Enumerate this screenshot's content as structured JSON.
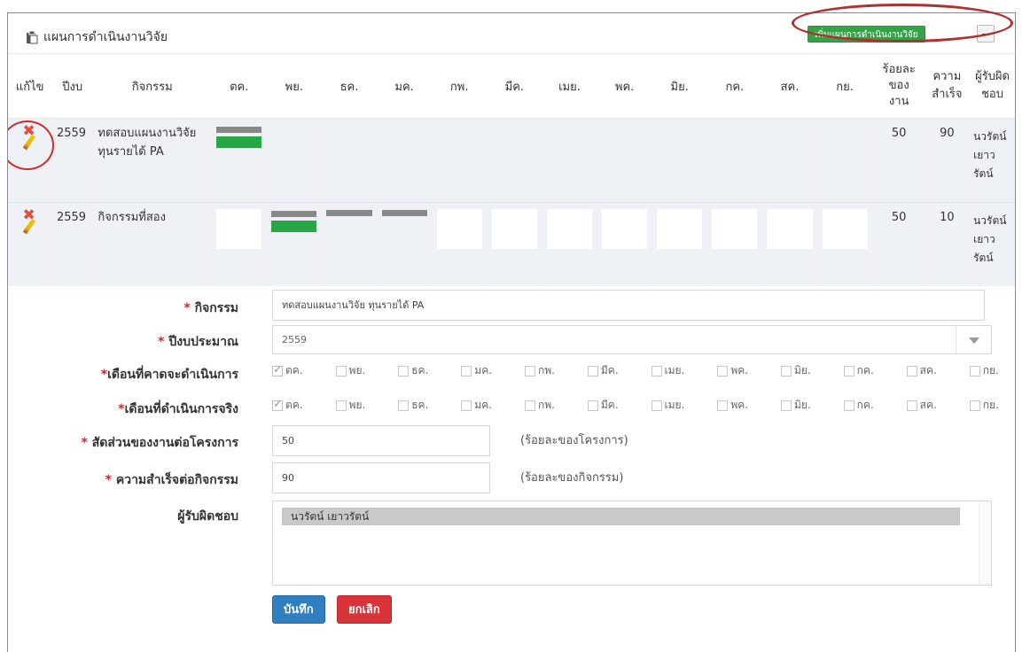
{
  "panel": {
    "title": "แผนการดำเนินงานวิจัย",
    "add_button": "เพิ่มแผนการดำเนินงานวิจัย"
  },
  "table": {
    "headers": {
      "edit": "แก้ไข",
      "year": "ปีงบ",
      "activity": "กิจกรรม",
      "months": [
        "ตค.",
        "พย.",
        "ธค.",
        "มค.",
        "กพ.",
        "มีค.",
        "เมย.",
        "พค.",
        "มิย.",
        "กค.",
        "สค.",
        "กย."
      ],
      "percent_line1": "ร้อยละ",
      "percent_line2": "ของ",
      "percent_line3": "งาน",
      "success_line1": "ความ",
      "success_line2": "สำเร็จ",
      "owner_line1": "ผู้รับผิด",
      "owner_line2": "ชอบ"
    },
    "rows": [
      {
        "year": "2559",
        "activity": "ทดสอบแผนงานวิจัย ทุนรายได้ PA",
        "percent": "50",
        "success": "90",
        "owner": "นวรัตน์ เยาวรัตน์",
        "planned_months": [
          "ตค."
        ],
        "actual_months": [
          "ตค."
        ]
      },
      {
        "year": "2559",
        "activity": "กิจกรรมที่สอง",
        "percent": "50",
        "success": "10",
        "owner": "นวรัตน์ เยาวรัตน์",
        "planned_months": [
          "พย.",
          "ธค.",
          "มค."
        ],
        "actual_months": [
          "พย."
        ]
      }
    ]
  },
  "form": {
    "activity_label": "กิจกรรม",
    "activity_value": "ทดสอบแผนงานวิจัย ทุนรายได้ PA",
    "year_label": "ปีงบประมาณ",
    "year_value": "2559",
    "planned_label": "เดือนที่คาดจะดำเนินการ",
    "actual_label": "เดือนที่ดำเนินการจริง",
    "month_options": [
      "ตค.",
      "พย.",
      "ธค.",
      "มค.",
      "กพ.",
      "มีค.",
      "เมย.",
      "พค.",
      "มิย.",
      "กค.",
      "สค.",
      "กย."
    ],
    "planned_checked": [
      "ตค."
    ],
    "actual_checked": [
      "ตค."
    ],
    "share_label": "สัดส่วนของงานต่อโครงการ",
    "share_value": "50",
    "share_hint": "(ร้อยละของโครงการ)",
    "success_label": "ความสำเร็จต่อกิจกรรม",
    "success_value": "90",
    "success_hint": "(ร้อยละของกิจกรรม)",
    "owner_label": "ผู้รับผิดชอบ",
    "owner_value": "นวรัตน์ เยาวรัตน์",
    "save_button": "บันทึก",
    "cancel_button": "ยกเลิก"
  },
  "colors": {
    "plan_bar": "#888888",
    "actual_bar": "#26a644",
    "add_button": "#31a545",
    "save_button": "#2f7fc1",
    "cancel_button": "#d9343a",
    "required": "#e02020",
    "annotation": "#b03030"
  },
  "icons": [
    "clipboard-icon",
    "delete-icon",
    "edit-pencil-icon",
    "minus-icon",
    "dropdown-caret-icon",
    "checkbox-icon"
  ]
}
